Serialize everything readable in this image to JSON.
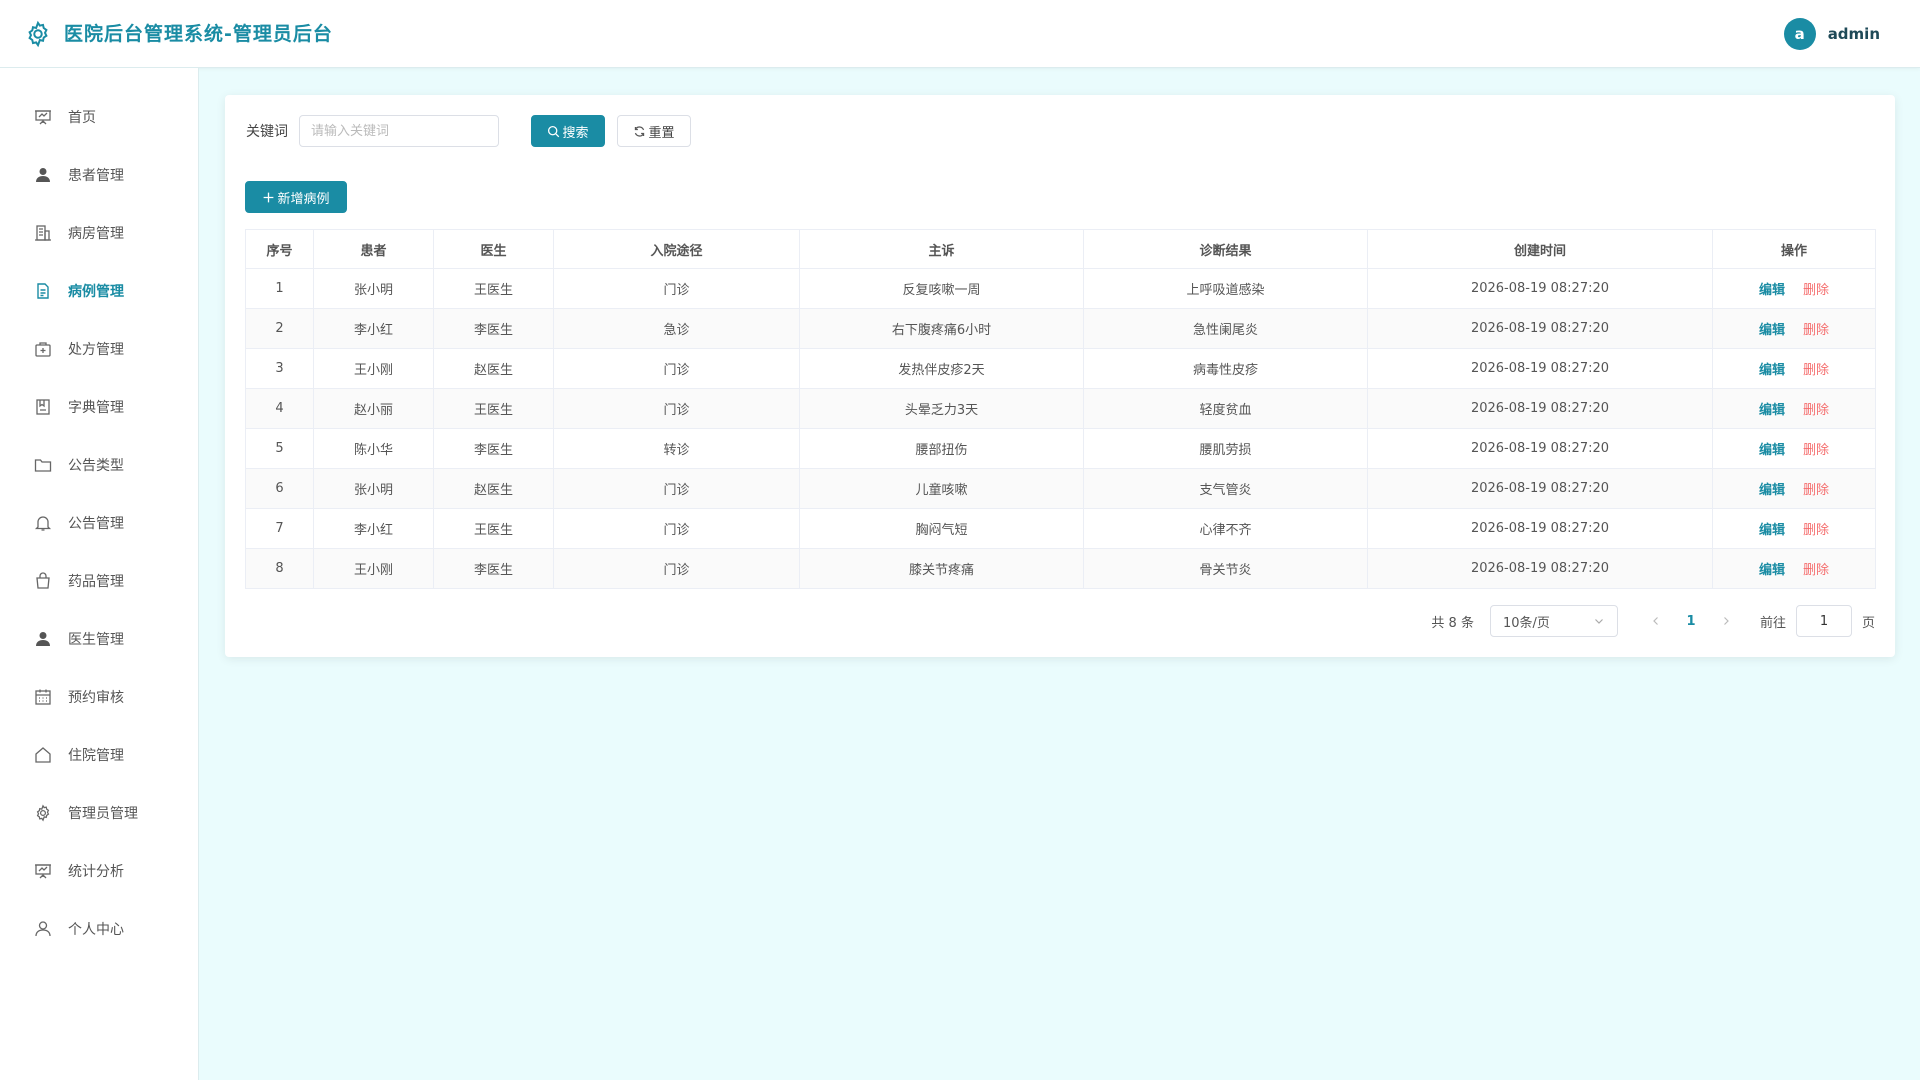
{
  "header": {
    "title": "医院后台管理系统-管理员后台",
    "avatar_letter": "a",
    "username": "admin"
  },
  "sidebar": {
    "items": [
      {
        "label": "首页",
        "icon": "presentation-icon"
      },
      {
        "label": "患者管理",
        "icon": "user-filled-icon"
      },
      {
        "label": "病房管理",
        "icon": "building-icon"
      },
      {
        "label": "病例管理",
        "icon": "document-icon",
        "active": true
      },
      {
        "label": "处方管理",
        "icon": "first-aid-kit-icon"
      },
      {
        "label": "字典管理",
        "icon": "notebook-icon"
      },
      {
        "label": "公告类型",
        "icon": "folder-icon"
      },
      {
        "label": "公告管理",
        "icon": "bell-icon"
      },
      {
        "label": "药品管理",
        "icon": "shopping-bag-icon"
      },
      {
        "label": "医生管理",
        "icon": "user-filled-icon"
      },
      {
        "label": "预约审核",
        "icon": "calendar-icon"
      },
      {
        "label": "住院管理",
        "icon": "house-icon"
      },
      {
        "label": "管理员管理",
        "icon": "gear-icon"
      },
      {
        "label": "统计分析",
        "icon": "presentation-icon"
      },
      {
        "label": "个人中心",
        "icon": "user-outline-icon"
      }
    ]
  },
  "search": {
    "label": "关键词",
    "placeholder": "请输入关键词",
    "value": "",
    "search_label": "搜索",
    "reset_label": "重置"
  },
  "toolbar": {
    "add_label": "新增病例"
  },
  "table": {
    "columns": [
      "序号",
      "患者",
      "医生",
      "入院途径",
      "主诉",
      "诊断结果",
      "创建时间",
      "操作"
    ],
    "edit_label": "编辑",
    "delete_label": "删除",
    "rows": [
      [
        "1",
        "张小明",
        "王医生",
        "门诊",
        "反复咳嗽一周",
        "上呼吸道感染",
        "2026-08-19 08:27:20"
      ],
      [
        "2",
        "李小红",
        "李医生",
        "急诊",
        "右下腹疼痛6小时",
        "急性阑尾炎",
        "2026-08-19 08:27:20"
      ],
      [
        "3",
        "王小刚",
        "赵医生",
        "门诊",
        "发热伴皮疹2天",
        "病毒性皮疹",
        "2026-08-19 08:27:20"
      ],
      [
        "4",
        "赵小丽",
        "王医生",
        "门诊",
        "头晕乏力3天",
        "轻度贫血",
        "2026-08-19 08:27:20"
      ],
      [
        "5",
        "陈小华",
        "李医生",
        "转诊",
        "腰部扭伤",
        "腰肌劳损",
        "2026-08-19 08:27:20"
      ],
      [
        "6",
        "张小明",
        "赵医生",
        "门诊",
        "儿童咳嗽",
        "支气管炎",
        "2026-08-19 08:27:20"
      ],
      [
        "7",
        "李小红",
        "王医生",
        "门诊",
        "胸闷气短",
        "心律不齐",
        "2026-08-19 08:27:20"
      ],
      [
        "8",
        "王小刚",
        "李医生",
        "门诊",
        "膝关节疼痛",
        "骨关节炎",
        "2026-08-19 08:27:20"
      ]
    ]
  },
  "pagination": {
    "total_text": "共 8 条",
    "page_size": "10条/页",
    "current_page": "1",
    "jump_label": "前往",
    "jump_value": "1",
    "jump_suffix": "页"
  },
  "colors": {
    "accent": "#1a8ca4",
    "danger": "#f56c6c",
    "background": "#eafcfd"
  }
}
